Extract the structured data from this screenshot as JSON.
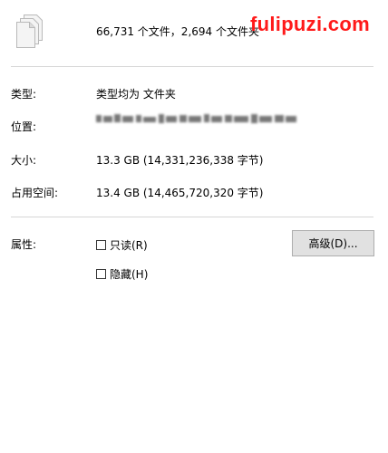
{
  "summary": "66,731 个文件，2,694 个文件夹",
  "watermark": "fulipuzi.com",
  "fields": {
    "type_label": "类型:",
    "type_value": "类型均为 文件夹",
    "location_label": "位置:",
    "size_label": "大小:",
    "size_value": "13.3 GB (14,331,236,338 字节)",
    "disk_label": "占用空间:",
    "disk_value": "13.4 GB (14,465,720,320 字节)"
  },
  "attributes": {
    "label": "属性:",
    "readonly_label": "只读(R)",
    "readonly_checked": false,
    "hidden_label": "隐藏(H)",
    "hidden_checked": false,
    "advanced_button": "高级(D)..."
  },
  "icons": {
    "files": "multiple-files-icon",
    "checkbox": "checkbox-icon"
  }
}
